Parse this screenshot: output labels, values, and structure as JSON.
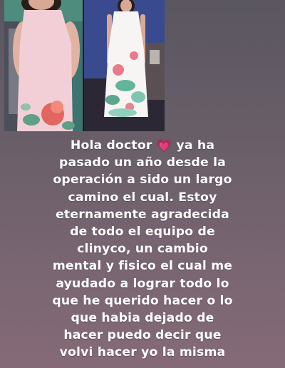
{
  "story": {
    "lines": [
      "Hola doctor",
      "ya ha",
      "pasado un año desde la",
      "operación a sido un largo",
      "camino el cual. Estoy",
      "eternamente agradecida",
      "de todo el equipo de",
      "clinyco,  un cambio",
      "mental y fisico el cual me",
      "ayudado a lograr todo lo",
      "que he querido hacer o lo",
      "que habia dejado de",
      "hacer puedo decir que",
      "volvi hacer yo la misma"
    ],
    "heart_icon": "💗"
  }
}
